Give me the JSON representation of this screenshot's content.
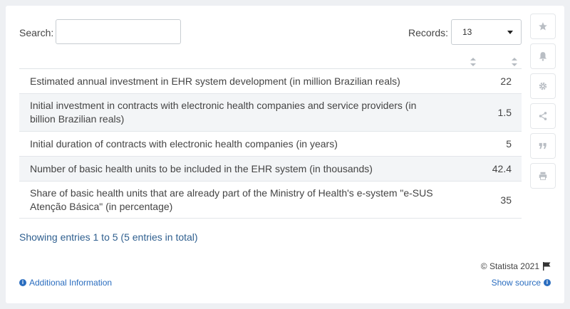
{
  "search": {
    "label": "Search:",
    "value": "",
    "placeholder": ""
  },
  "records": {
    "label": "Records:",
    "value": "13"
  },
  "table": {
    "rows": [
      {
        "label": "Estimated annual investment in EHR system development (in million Brazilian reals)",
        "value": "22"
      },
      {
        "label": "Initial investment in contracts with electronic health companies and service providers (in billion Brazilian reals)",
        "value": "1.5"
      },
      {
        "label": "Initial duration of contracts with electronic health companies (in years)",
        "value": "5"
      },
      {
        "label": "Number of basic health units to be included in the EHR system (in thousands)",
        "value": "42.4"
      },
      {
        "label": "Share of basic health units that are already part of the Ministry of Health's e-system \"e-SUS Atenção Básica\" (in percentage)",
        "value": "35"
      }
    ]
  },
  "summary": "Showing entries 1 to 5 (5 entries in total)",
  "footer": {
    "copyright": "© Statista 2021",
    "additional_info": "Additional Information",
    "show_source": "Show source"
  },
  "sidebar": {
    "icons": [
      "star-icon",
      "bell-icon",
      "gear-icon",
      "share-icon",
      "quote-icon",
      "print-icon"
    ]
  },
  "colors": {
    "link": "#2a6dbf",
    "summary": "#2f5f8f",
    "alt_row": "#f3f5f7",
    "icon": "#b9bec4"
  }
}
